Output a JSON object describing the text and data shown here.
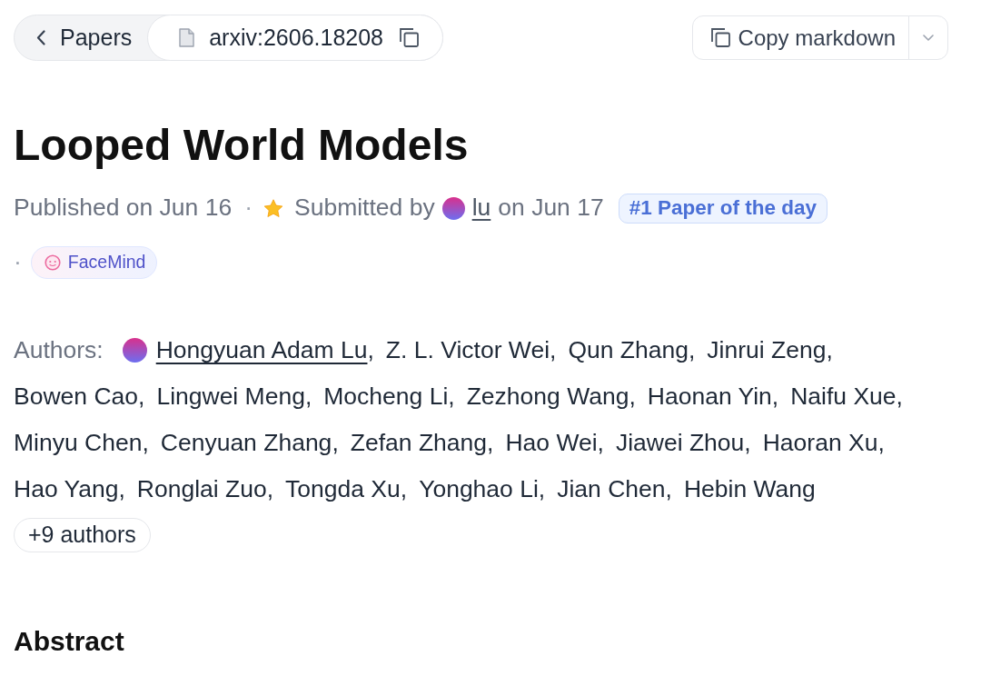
{
  "breadcrumb": {
    "back_label": "Papers",
    "paper_id": "arxiv:2606.18208"
  },
  "copy_menu": {
    "label": "Copy markdown"
  },
  "title": "Looped World Models",
  "meta": [
    {
      "kind": "date",
      "text": "Published on Jun 16"
    },
    {
      "kind": "submitter",
      "separator": "·",
      "prefix": "Submitted by",
      "user": "lu",
      "suffix": "on Jun 17"
    },
    {
      "kind": "badge",
      "text": "#1 Paper of the day"
    },
    {
      "kind": "org",
      "separator": "·",
      "text": "FaceMind"
    }
  ],
  "authors": {
    "label": "Authors:",
    "items": [
      {
        "name": "Hongyuan Adam Lu",
        "punct": ",",
        "claimed": true
      },
      {
        "name": "Z. L. Victor Wei",
        "punct": ",",
        "claimed": false
      },
      {
        "name": "Qun Zhang",
        "punct": ",",
        "claimed": false
      },
      {
        "name": "Jinrui Zeng",
        "punct": ",",
        "claimed": false
      },
      {
        "name": "Bowen Cao",
        "punct": ",",
        "claimed": false
      },
      {
        "name": "Lingwei Meng",
        "punct": ",",
        "claimed": false
      },
      {
        "name": "Mocheng Li",
        "punct": ",",
        "claimed": false
      },
      {
        "name": "Zezhong Wang",
        "punct": ",",
        "claimed": false
      },
      {
        "name": "Haonan Yin",
        "punct": ",",
        "claimed": false
      },
      {
        "name": "Naifu Xue",
        "punct": ",",
        "claimed": false
      },
      {
        "name": "Minyu Chen",
        "punct": ",",
        "claimed": false
      },
      {
        "name": "Cenyuan Zhang",
        "punct": ",",
        "claimed": false
      },
      {
        "name": "Zefan Zhang",
        "punct": ",",
        "claimed": false
      },
      {
        "name": "Hao Wei",
        "punct": ",",
        "claimed": false
      },
      {
        "name": "Jiawei Zhou",
        "punct": ",",
        "claimed": false
      },
      {
        "name": "Haoran Xu",
        "punct": ",",
        "claimed": false
      },
      {
        "name": "Hao Yang",
        "punct": ",",
        "claimed": false
      },
      {
        "name": "Ronglai Zuo",
        "punct": ",",
        "claimed": false
      },
      {
        "name": "Tongda Xu",
        "punct": ",",
        "claimed": false
      },
      {
        "name": "Yonghao Li",
        "punct": ",",
        "claimed": false
      },
      {
        "name": "Jian Chen",
        "punct": ",",
        "claimed": false
      },
      {
        "name": "Hebin Wang",
        "claimed": false
      }
    ],
    "more_button": "+9 authors"
  },
  "section_heading": "Abstract"
}
